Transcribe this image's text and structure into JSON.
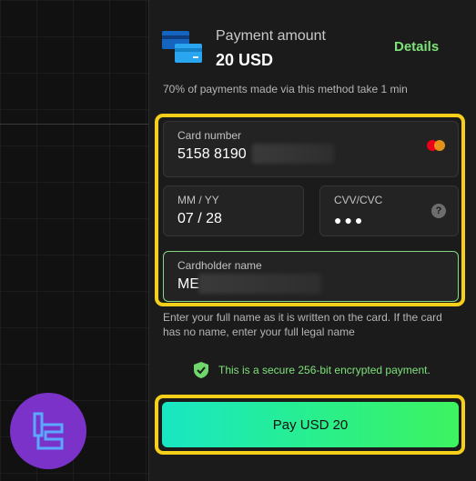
{
  "payment": {
    "amount_label": "Payment amount",
    "amount_value": "20 USD",
    "details_link": "Details",
    "stat_text": "70% of payments made via this method take 1 min"
  },
  "form": {
    "card_number_label": "Card number",
    "card_number_value": "5158 8190",
    "expiry_label": "MM / YY",
    "expiry_value": "07 / 28",
    "cvv_label": "CVV/CVC",
    "cvv_value": "●●●",
    "cardholder_label": "Cardholder name",
    "cardholder_value": "ME",
    "help_glyph": "?",
    "hint_text": "Enter your full name as it is written on the card. If the card has no name, enter your full legal name"
  },
  "security": {
    "text": "This is a secure 256-bit encrypted payment."
  },
  "actions": {
    "pay_button": "Pay USD 20"
  },
  "icons": {
    "card_icon": "credit-card-icon",
    "mastercard": "mastercard-icon",
    "shield": "shield-check-icon",
    "help": "help-circle-icon",
    "logo": "broker-logo-icon"
  },
  "colors": {
    "accent_green": "#7ee27a",
    "highlight_yellow": "#f5cf1a",
    "logo_purple": "#7a32c8",
    "card_blue": "#1ea0e8"
  }
}
